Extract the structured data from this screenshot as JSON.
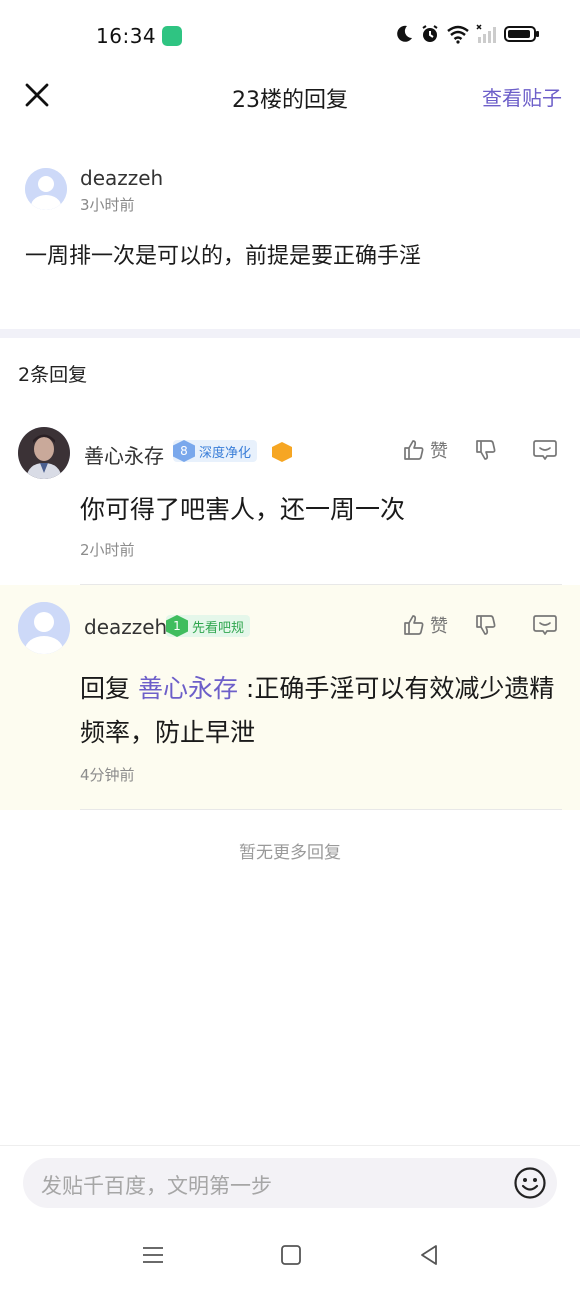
{
  "status_bar": {
    "time": "16:34"
  },
  "nav": {
    "title": "23楼的回复",
    "view_post": "查看贴子"
  },
  "original_post": {
    "username": "deazzeh",
    "time": "3小时前",
    "content": "一周排一次是可以的，前提是要正确手淫"
  },
  "reply_section": {
    "count_label": "2条回复",
    "no_more": "暂无更多回复"
  },
  "replies": [
    {
      "username": "善心永存",
      "badge_level": "8",
      "badge_text": "深度净化",
      "content": "你可得了吧害人，还一周一次",
      "time": "2小时前",
      "like_label": "赞"
    },
    {
      "username": "deazzeh",
      "badge_level": "1",
      "badge_text": "先看吧规",
      "reply_prefix": "回复 ",
      "reply_to": "善心永存",
      "content": " :正确手淫可以有效减少遗精频率，防止早泄",
      "time": "4分钟前",
      "like_label": "赞"
    }
  ],
  "input": {
    "placeholder": "发贴千百度，文明第一步"
  },
  "colors": {
    "accent": "#6d5fc9",
    "highlight_bg": "#fdfcf0",
    "separator_band": "#f1f1f8"
  }
}
